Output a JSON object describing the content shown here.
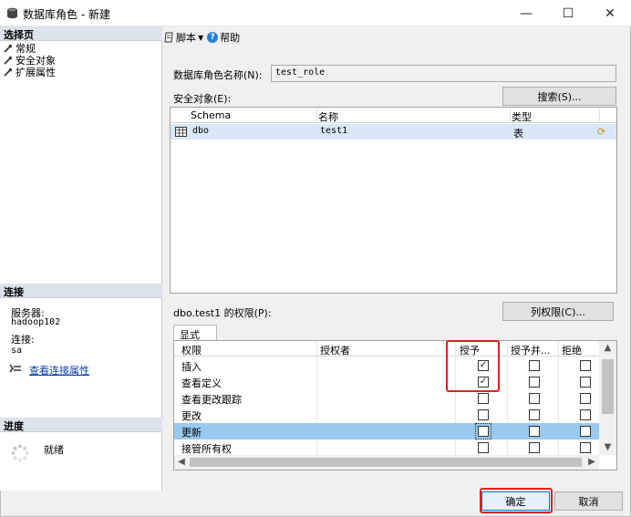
{
  "window": {
    "title": "数据库角色 - 新建",
    "min_glyph": "—",
    "max_glyph": "☐",
    "close_glyph": "✕"
  },
  "left": {
    "select_page_header": "选择页",
    "pages": [
      "常规",
      "安全对象",
      "扩展属性"
    ],
    "connection_header": "连接",
    "server_label": "服务器:",
    "server_value": "hadoop102",
    "connection_label": "连接:",
    "connection_value": "sa",
    "view_connection_link": "查看连接属性",
    "progress_header": "进度",
    "progress_status": "就绪"
  },
  "toolbar": {
    "script_label": "脚本",
    "help_label": "帮助"
  },
  "form": {
    "role_name_label": "数据库角色名称(N):",
    "role_name_value": "test_role",
    "securables_label": "安全对象(E):",
    "search_button": "搜索(S)..."
  },
  "securables": {
    "columns": [
      "Schema",
      "名称",
      "类型"
    ],
    "rows": [
      {
        "schema": "dbo",
        "name": "test1",
        "type": "表"
      }
    ]
  },
  "permissions": {
    "label": "dbo.test1 的权限(P):",
    "column_permissions_button": "列权限(C)...",
    "tab": "显式",
    "columns": [
      "权限",
      "授权者",
      "授予",
      "授予并...",
      "拒绝"
    ],
    "rows": [
      {
        "name": "插入",
        "grant": true,
        "with_grant": false,
        "deny": false,
        "selected": false
      },
      {
        "name": "查看定义",
        "grant": true,
        "with_grant": false,
        "deny": false,
        "selected": false
      },
      {
        "name": "查看更改跟踪",
        "grant": false,
        "with_grant": false,
        "deny": false,
        "selected": false
      },
      {
        "name": "更改",
        "grant": false,
        "with_grant": false,
        "deny": false,
        "selected": false
      },
      {
        "name": "更新",
        "grant": false,
        "with_grant": false,
        "deny": false,
        "selected": true
      },
      {
        "name": "接管所有权",
        "grant": false,
        "with_grant": false,
        "deny": false,
        "selected": false
      }
    ]
  },
  "footer": {
    "ok_button": "确定",
    "cancel_button": "取消"
  },
  "colors": {
    "highlight": "#e0201b",
    "selected_row": "#99c9ef",
    "section_header": "#dde3ec"
  }
}
